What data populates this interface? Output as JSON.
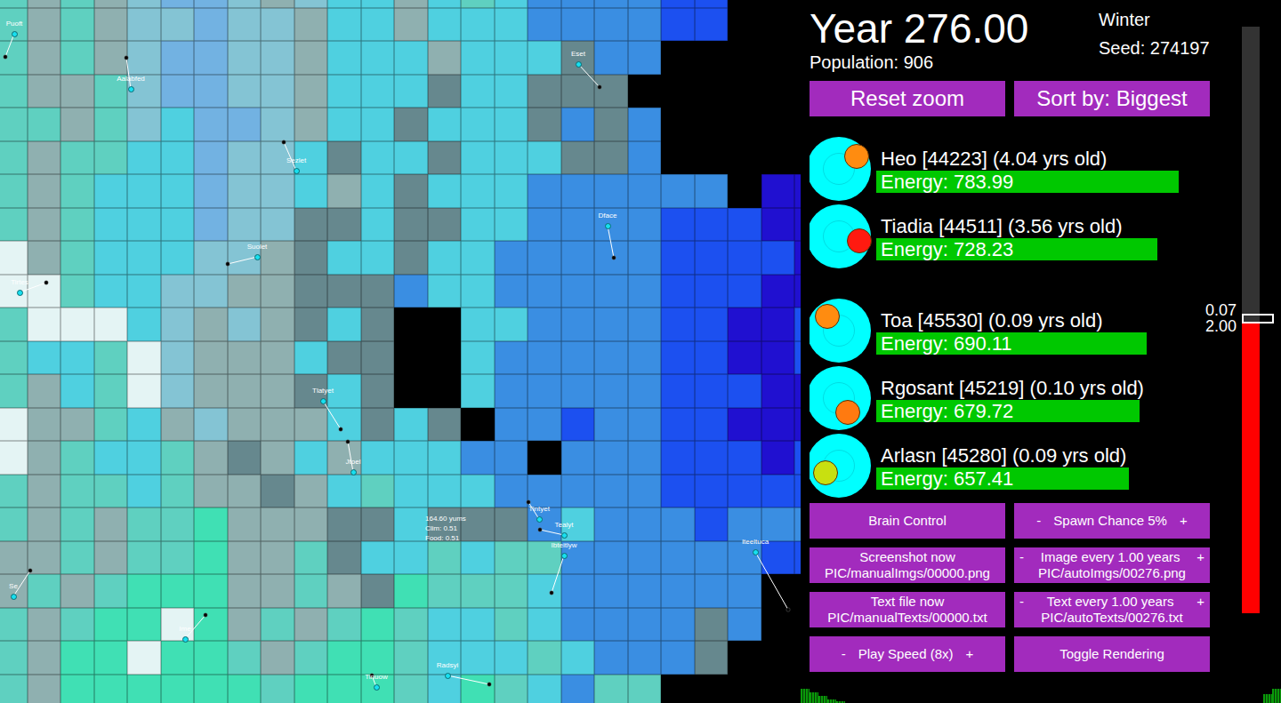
{
  "map": {
    "palette": {
      "k": "#000000",
      "t": "#5fd0c0",
      "g": "#8fb0b0",
      "c": "#4fd0e0",
      "s": "#84c4d4",
      "l": "#72b2e2",
      "b": "#3a8ee2",
      "d": "#1c50f0",
      "n": "#2010d0",
      "w": "#e4f4f4",
      "m": "#40e0b4",
      "G": "#66888e"
    },
    "tiles": [
      "tgtgsllsgsccgctcbbbbddkkk",
      "tgtgsslssgccgcccbbbbddkkk",
      "tgtgsllssgcccgcccGbbkkkkk",
      "tggtsllssgcccGccGGGkkkkkk",
      "ttgtscllsgccGcccGbGbkkkkk",
      "tgttcclsscGccGcccGGbkkkkk",
      "tgtccclsscgcGcccbbbbbbknn",
      "tgtccclssGGcGGccbbbbdddnn",
      "wgtcccssgGccGccbbbbbddddn",
      "wwtccssggGGGbccbbbbbdddnn",
      "twwwcsgsgGcGkkccbbbbddnnd",
      "tcctwsgggcGGkkcbbbbbddnnd",
      "tgctwsgggGcGkkcbbbbbdddnn",
      "wggtcgsgggcGcGkbbdbbddnnn",
      "wgtcctgGgcgcccbbkbbbdddnd",
      "tgttctggGgctcccbbbbbddddd",
      "tgtgttmgggGGcGGGbcbbbdbbb",
      "ggtgttmggtGcctcttbbbbbbdd",
      "gtgtmmmggtgGmtttcbbbbbbkk",
      "tgtmmwmgtgtmtcctcbbbbGbkk",
      "tgmmwmmtgtmmtccctcbbbGkkk",
      "tgmmmmmmtmmmtcmtcbttkkkkk"
    ],
    "creatures": [
      {
        "name": "Puoft"
      },
      {
        "name": "Aalabfed"
      },
      {
        "name": "Eset"
      },
      {
        "name": "Sezlet"
      },
      {
        "name": "Suolet"
      },
      {
        "name": "Dface"
      },
      {
        "name": "Tirtes"
      },
      {
        "name": "Tlatyet"
      },
      {
        "name": "Jtoel"
      },
      {
        "name": "Tintyet"
      },
      {
        "name": "Tealyt"
      },
      {
        "name": "Ibteitlyw"
      },
      {
        "name": "Iteeltuca"
      },
      {
        "name": "Se"
      },
      {
        "name": "Ime"
      },
      {
        "name": "Radsyi"
      },
      {
        "name": "Tinuow"
      }
    ],
    "tile_info": [
      "164.60 yums",
      "Clim: 0.51",
      "Food: 0.51"
    ]
  },
  "header": {
    "year": "Year 276.00",
    "season": "Winter",
    "seed": "Seed: 274197",
    "population": "Population: 906"
  },
  "top_buttons": [
    {
      "label": "Reset zoom"
    },
    {
      "label": "Sort by: Biggest"
    }
  ],
  "creature_list": [
    {
      "title": "Heo [44223] (4.04 yrs old)",
      "energy": "Energy: 783.99",
      "level": 0.85,
      "color": "#ff8c10"
    },
    {
      "title": "Tiadia [44511] (3.56 yrs old)",
      "energy": "Energy: 728.23",
      "level": 0.79,
      "color": "#ff1a10"
    },
    {
      "title": "Toa [45530] (0.09 yrs old)",
      "energy": "Energy: 690.11",
      "level": 0.76,
      "color": "#ff8c10"
    },
    {
      "title": "Rgosant [45219] (0.10 yrs old)",
      "energy": "Energy: 679.72",
      "level": 0.74,
      "color": "#ff7a10"
    },
    {
      "title": "Arlasn [45280] (0.09 yrs old)",
      "energy": "Energy: 657.41",
      "level": 0.71,
      "color": "#c8e010"
    }
  ],
  "slider": {
    "level": 0.497,
    "labels": [
      "0.07",
      "2.00"
    ]
  },
  "buttons": [
    {
      "kind": "plain",
      "lines": [
        "Brain Control"
      ]
    },
    {
      "kind": "stepper",
      "minus": "-",
      "label": "Spawn Chance 5%",
      "plus": "+"
    },
    {
      "kind": "plain",
      "lines": [
        "Screenshot now",
        "PIC/manualImgs/00000.png"
      ]
    },
    {
      "kind": "stepper",
      "minus": "-",
      "label": "Image every 1.00 years",
      "plus": "+",
      "sub": "PIC/autoImgs/00276.png"
    },
    {
      "kind": "plain",
      "lines": [
        "Text file now",
        "PIC/manualTexts/00000.txt"
      ]
    },
    {
      "kind": "stepper",
      "minus": "-",
      "label": "Text every 1.00 years",
      "plus": "+",
      "sub": "PIC/autoTexts/00276.txt"
    },
    {
      "kind": "stepper",
      "minus": "-",
      "label": "Play Speed (8x)",
      "plus": "+"
    },
    {
      "kind": "plain",
      "lines": [
        "Toggle Rendering"
      ]
    }
  ],
  "graph": {
    "values": [
      16,
      12,
      8,
      4,
      2,
      0,
      0,
      0,
      0,
      0,
      0,
      0,
      0,
      0,
      0,
      0,
      0,
      0,
      0,
      0,
      0,
      0,
      0,
      0,
      0,
      0,
      0,
      0,
      0,
      0,
      0,
      0,
      0,
      0,
      0,
      0,
      0,
      0,
      0,
      0,
      0,
      0,
      0,
      0,
      0,
      0,
      0,
      0,
      0,
      0,
      0,
      0,
      10,
      16
    ]
  }
}
